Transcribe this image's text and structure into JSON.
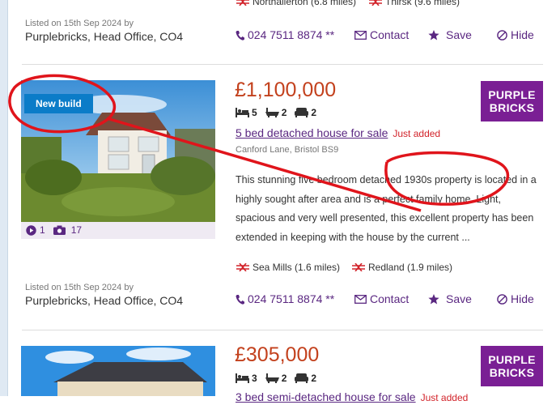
{
  "listing_top": {
    "stations": [
      {
        "name": "Northallerton (6.8 miles)"
      },
      {
        "name": "Thirsk (9.6 miles)"
      }
    ],
    "listed_on": "Listed on 15th Sep 2024 by",
    "agent": "Purplebricks, Head Office, CO4",
    "phone": "024 7511 8874 **",
    "actions": {
      "contact": "Contact",
      "save": "Save",
      "hide": "Hide"
    }
  },
  "listing_main": {
    "badge": "New build",
    "price": "£1,100,000",
    "beds": "5",
    "baths": "2",
    "receptions": "2",
    "title": "5 bed detached house for sale",
    "just_added": "Just added",
    "address": "Canford Lane, Bristol BS9",
    "description": "This stunning five bedroom detached 1930s property is located in a highly sought after area and is a perfect family home. Light, spacious and very well presented, this excellent property has been extended in keeping with the house by the current ...",
    "videos": "1",
    "photos": "17",
    "logo_line1": "PURPLE",
    "logo_line2": "BRICKS",
    "stations": [
      {
        "name": "Sea Mills (1.6 miles)"
      },
      {
        "name": "Redland (1.9 miles)"
      }
    ],
    "listed_on": "Listed on 15th Sep 2024 by",
    "agent": "Purplebricks, Head Office, CO4",
    "phone": "024 7511 8874 **",
    "actions": {
      "contact": "Contact",
      "save": "Save",
      "hide": "Hide"
    }
  },
  "listing_bottom": {
    "price": "£305,000",
    "beds": "3",
    "baths": "2",
    "receptions": "2",
    "title": "3 bed semi-detached house for sale",
    "just_added": "Just added",
    "logo_line1": "PURPLE",
    "logo_line2": "BRICKS"
  },
  "colors": {
    "accent": "#5a2781",
    "price": "#c3411d",
    "annotation": "#e0141b",
    "badge": "#0b7cc8",
    "logo": "#7a1f94"
  }
}
